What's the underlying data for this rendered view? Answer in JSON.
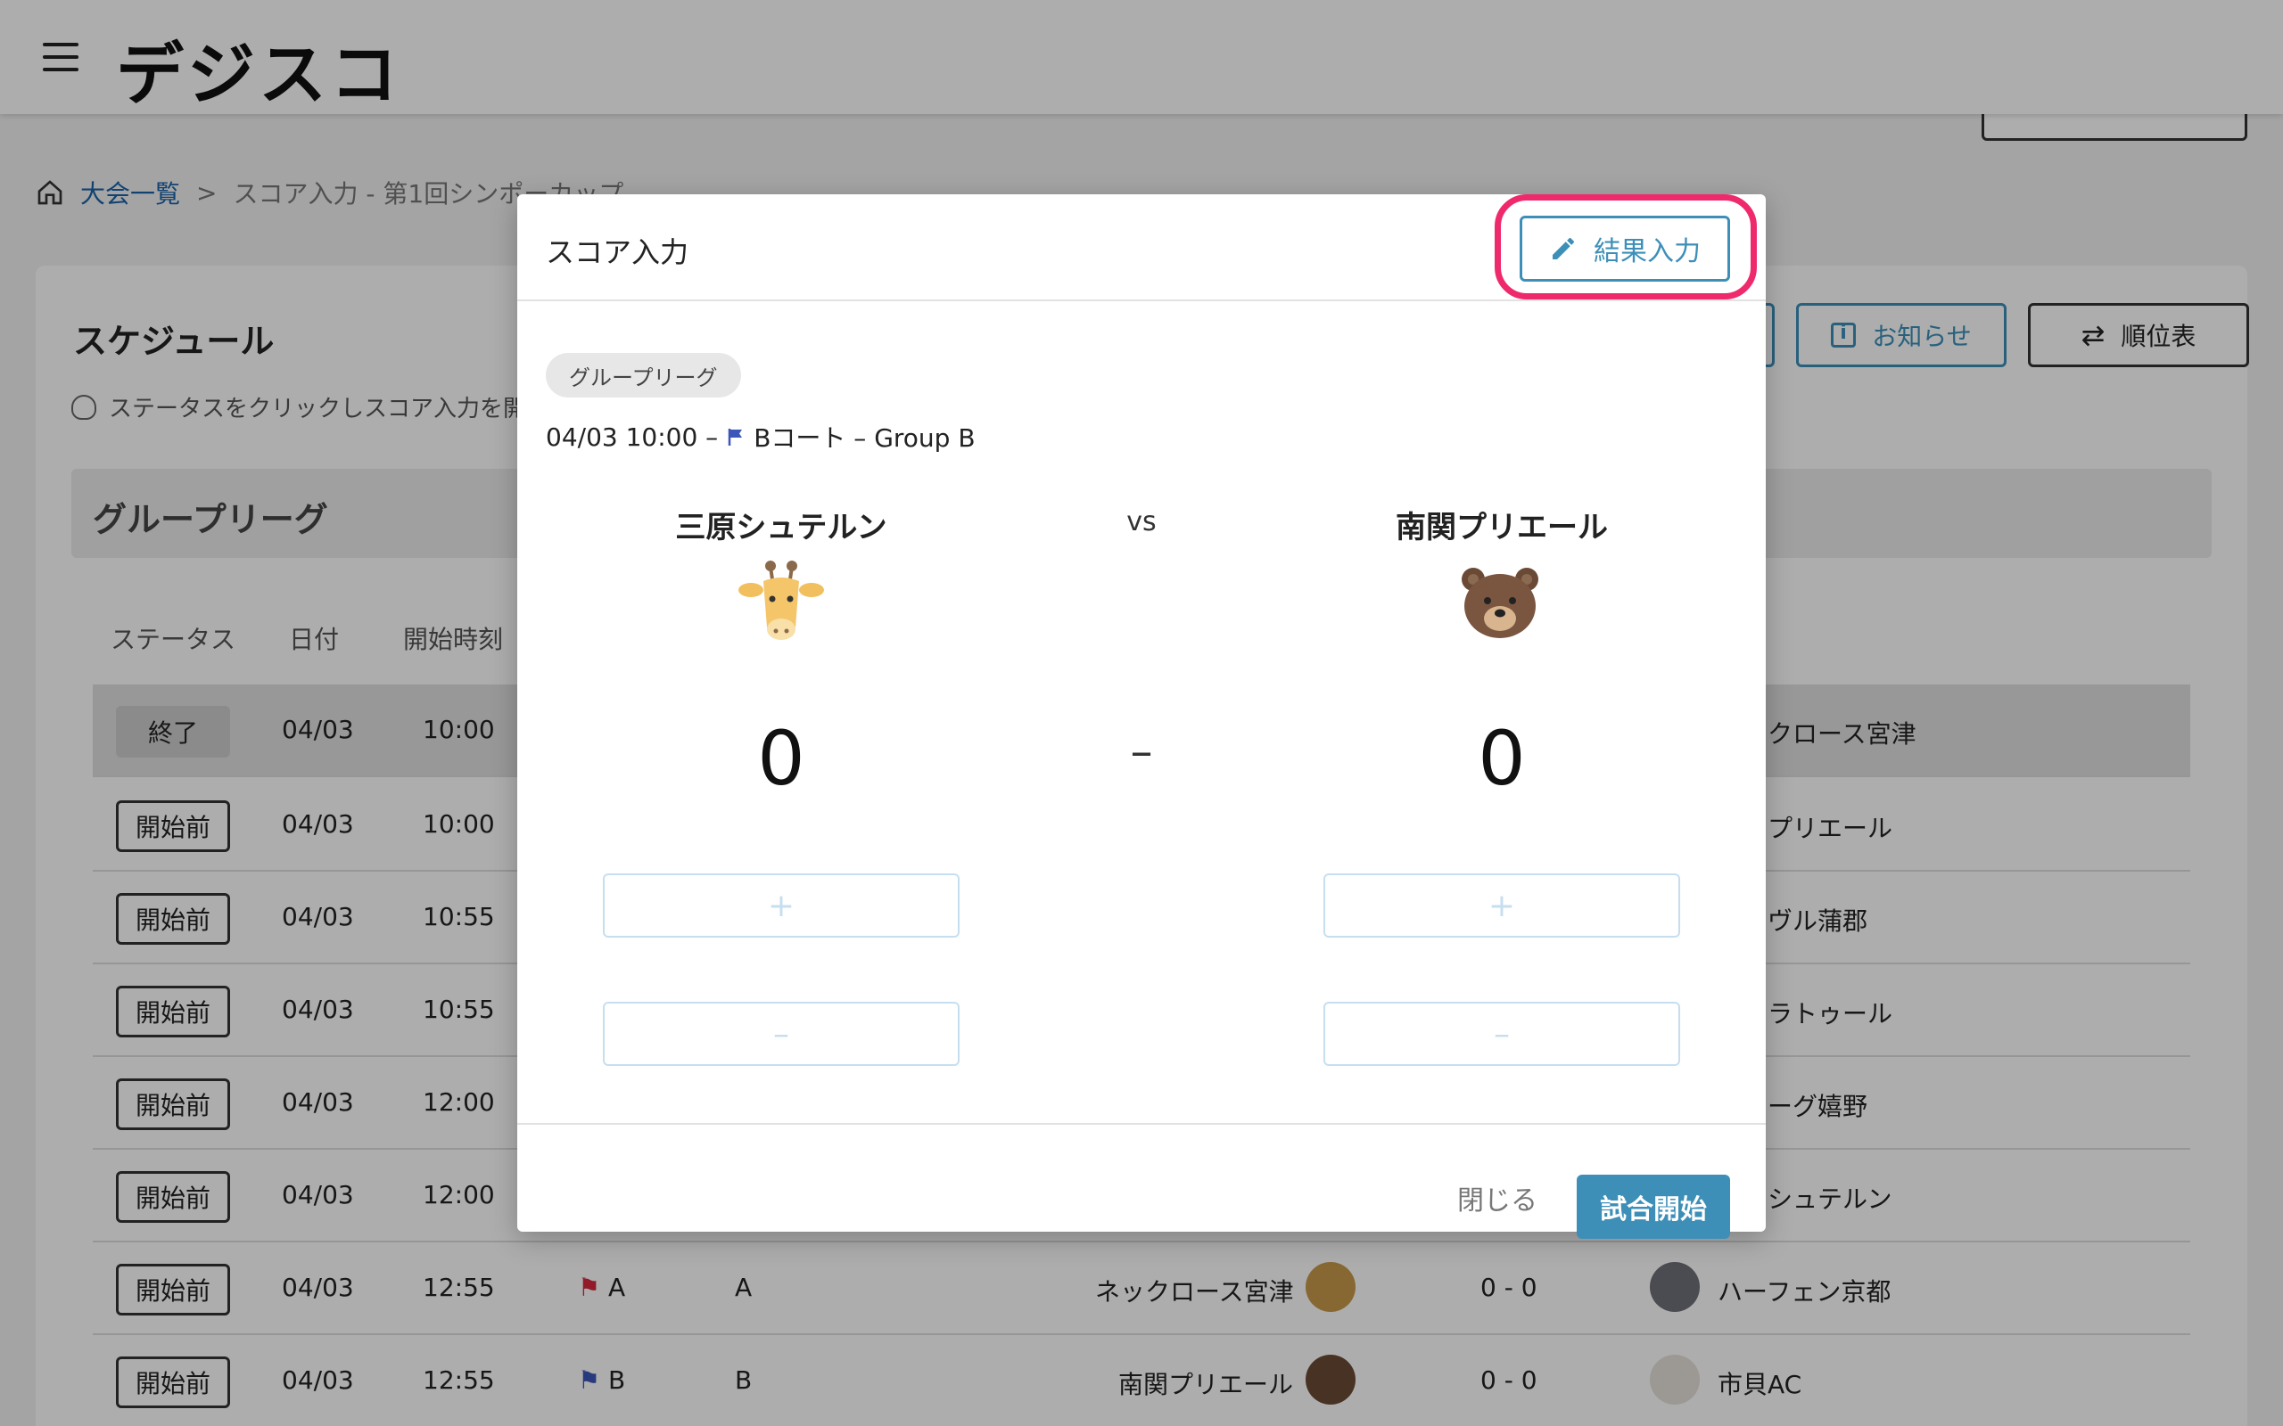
{
  "app": {
    "logo_text": "デジスコ",
    "brand_accent": "#e8003a"
  },
  "page": {
    "breadcrumb": {
      "home_label": "大会一覧",
      "separator": ">",
      "current": "スコア入力 - 第1回シンポーカップ"
    },
    "schedule_title": "スケジュール",
    "hint": "ステータスをクリックしスコア入力を開始",
    "toolbar": {
      "news_label": "お知らせ",
      "ranking_label": "順位表"
    },
    "group_title": "グループリーグ",
    "table_headers": [
      "ステータス",
      "日付",
      "開始時刻"
    ],
    "rows": [
      {
        "status": "終了",
        "date": "04/03",
        "time": "10:00",
        "court": "",
        "group": "",
        "home": "",
        "score": "",
        "away": "クロース宮津",
        "done": true
      },
      {
        "status": "開始前",
        "date": "04/03",
        "time": "10:00",
        "court": "",
        "group": "",
        "home": "",
        "score": "",
        "away": "プリエール"
      },
      {
        "status": "開始前",
        "date": "04/03",
        "time": "10:55",
        "court": "",
        "group": "",
        "home": "",
        "score": "",
        "away": "ヴル蒲郡"
      },
      {
        "status": "開始前",
        "date": "04/03",
        "time": "10:55",
        "court": "",
        "group": "",
        "home": "",
        "score": "",
        "away": "ラトゥール"
      },
      {
        "status": "開始前",
        "date": "04/03",
        "time": "12:00",
        "court": "",
        "group": "",
        "home": "",
        "score": "",
        "away": "ーグ嬉野"
      },
      {
        "status": "開始前",
        "date": "04/03",
        "time": "12:00",
        "court": "",
        "group": "",
        "home": "",
        "score": "",
        "away": "シュテルン"
      },
      {
        "status": "開始前",
        "date": "04/03",
        "time": "12:55",
        "court": "A",
        "group": "A",
        "home": "ネックロース宮津",
        "score": "0 - 0",
        "away": "ハーフェン京都"
      },
      {
        "status": "開始前",
        "date": "04/03",
        "time": "12:55",
        "court": "B",
        "group": "B",
        "home": "南関プリエール",
        "score": "0 - 0",
        "away": "市貝AC"
      }
    ]
  },
  "modal": {
    "title": "スコア入力",
    "result_button": "結果入力",
    "chip": "グループリーグ",
    "datetime": "04/03 10:00 –",
    "court": "Bコート – Group B",
    "home_team": "三原シュテルン",
    "away_team": "南関プリエール",
    "vs": "vs",
    "home_score": "0",
    "away_score": "0",
    "dash": "–",
    "plus": "+",
    "minus": "–",
    "close_label": "閉じる",
    "start_label": "試合開始",
    "accent": "#3d8fb8",
    "highlight": "#ef2a6c"
  }
}
